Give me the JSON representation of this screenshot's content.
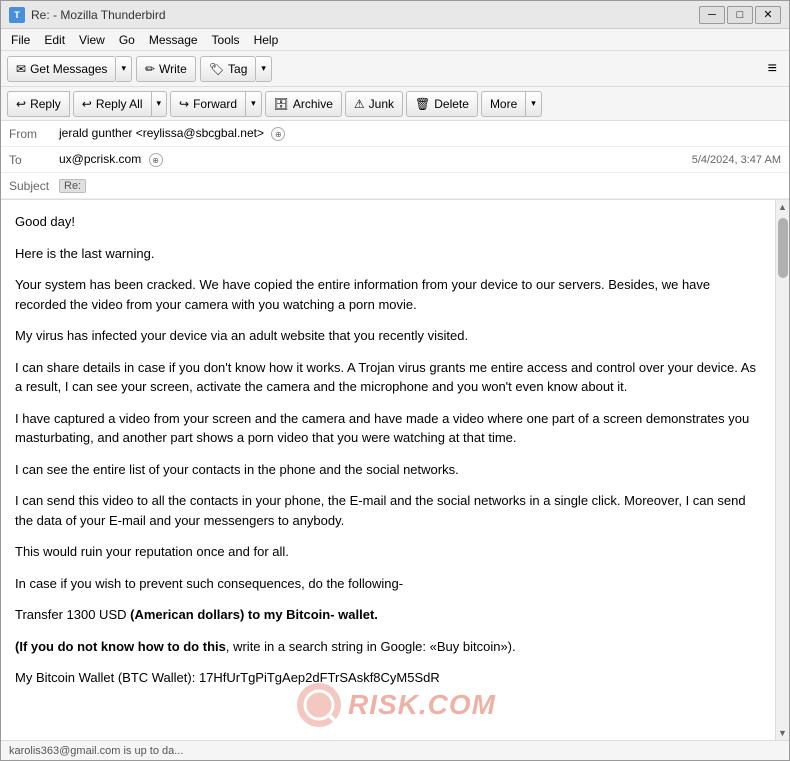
{
  "window": {
    "title": "Re: - Mozilla Thunderbird",
    "icon": "T"
  },
  "menu": {
    "items": [
      "File",
      "Edit",
      "View",
      "Go",
      "Message",
      "Tools",
      "Help"
    ]
  },
  "toolbar": {
    "get_messages_label": "Get Messages",
    "write_label": "Write",
    "tag_label": "Tag"
  },
  "action_bar": {
    "reply_label": "Reply",
    "reply_all_label": "Reply All",
    "forward_label": "Forward",
    "archive_label": "Archive",
    "junk_label": "Junk",
    "delete_label": "Delete",
    "more_label": "More"
  },
  "email": {
    "from_label": "From",
    "from_name": "jerald gunther <reylissa@sbcgbal.net>",
    "to_label": "To",
    "to_value": "ux@pcrisk.com",
    "subject_label": "Subject",
    "subject_badge": "Re:",
    "date": "5/4/2024, 3:47 AM",
    "body": [
      {
        "id": 1,
        "text": "Good day!",
        "bold": false
      },
      {
        "id": 2,
        "text": "Here is the last warning.",
        "bold": false
      },
      {
        "id": 3,
        "text": "Your system has been cracked. We have copied the entire information from your device to our servers. Besides, we have recorded the video from your camera with you watching a porn movie.",
        "bold": false
      },
      {
        "id": 4,
        "text": "My virus has infected your device via an adult website that you recently visited.",
        "bold": false
      },
      {
        "id": 5,
        "text": "I can share details in case if you don't know how it works. A Trojan virus grants me entire access and control over your device. As a result, I can see your screen, activate the camera and the microphone and you won't even know about it.",
        "bold": false
      },
      {
        "id": 6,
        "text": "I have captured a video from your screen and the camera and have made a video where one part of a screen demonstrates you masturbating, and another part shows a porn video that you were watching at that time.",
        "bold": false
      },
      {
        "id": 7,
        "text": "I can see the entire list of your contacts in the phone and the social networks.",
        "bold": false
      },
      {
        "id": 8,
        "text": "I can send this video to all the contacts in your phone, the E-mail and the social networks in a single click. Moreover, I can send the data of your E-mail and your messengers to anybody.",
        "bold": false
      },
      {
        "id": 9,
        "text": "This would ruin your reputation once and for all.",
        "bold": false
      },
      {
        "id": 10,
        "text": "In case if you wish to prevent such consequences, do the following-",
        "bold": false
      },
      {
        "id": 11,
        "text_parts": [
          {
            "text": "Transfer 1300 USD ",
            "bold": false
          },
          {
            "text": "(American dollars) to my Bitcoin- wallet.",
            "bold": true
          }
        ]
      },
      {
        "id": 12,
        "text_parts": [
          {
            "text": "(If you do not know how to do this",
            "bold": true
          },
          {
            "text": ", write in a search string in Google: «Buy bitcoin\").",
            "bold": false
          }
        ]
      },
      {
        "id": 13,
        "text": "My Bitcoin Wallet (BTC Wallet): 17HfUrTgPiTgAep2dFTrSAskf8CyM5SdR",
        "bold": false
      }
    ]
  },
  "status_bar": {
    "text": "karolis363@gmail.com is up to da..."
  },
  "icons": {
    "reply": "↩",
    "reply_all": "↩↩",
    "forward": "↪",
    "archive": "🗄",
    "junk": "⚠",
    "delete": "🗑",
    "more_arrow": "▼",
    "get_messages_arrow": "▼",
    "tag_arrow": "▼",
    "minimize": "─",
    "maximize": "□",
    "close": "✕",
    "write": "✏",
    "tag": "🏷",
    "envelope": "✉",
    "hamburger": "≡",
    "chevron_down": "▾",
    "person": "👤",
    "search": "🔍"
  }
}
